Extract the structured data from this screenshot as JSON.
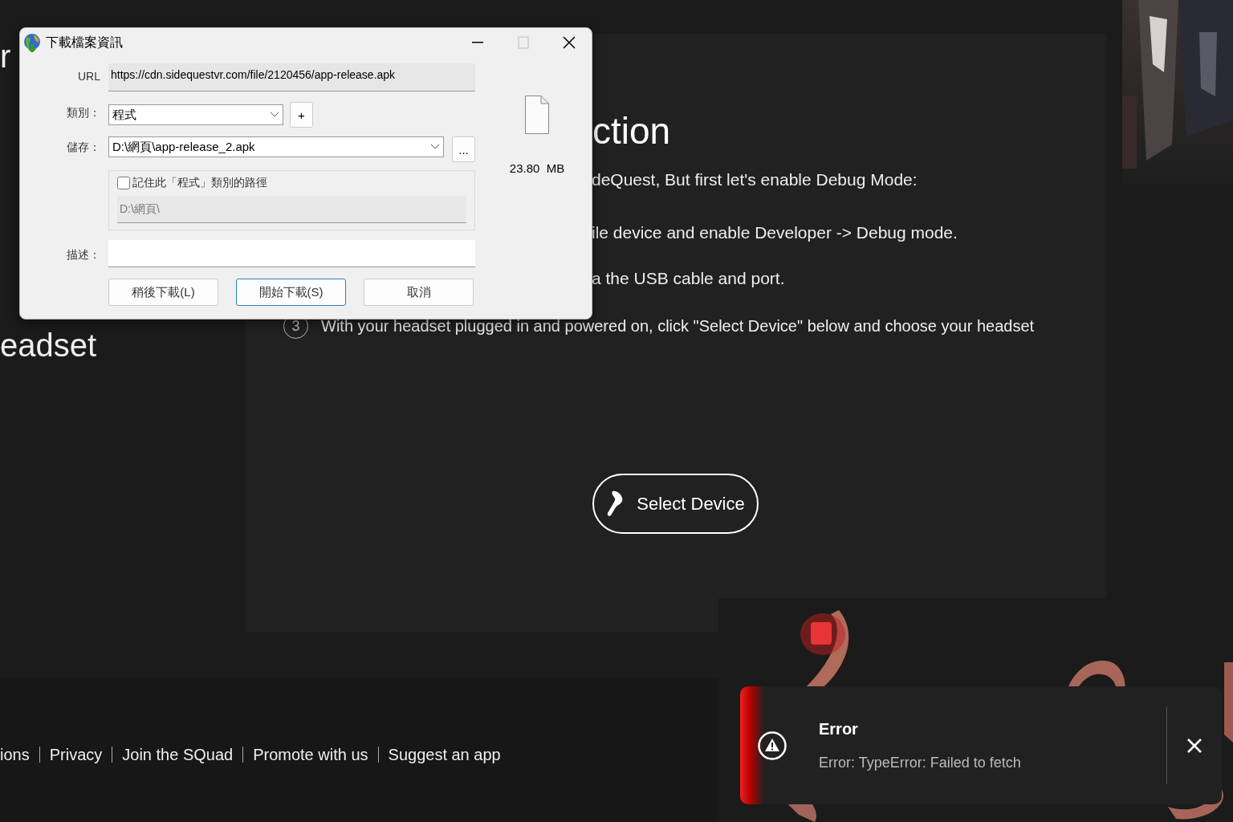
{
  "background_page": {
    "left_texts": [
      "r",
      "eadset"
    ],
    "heading": "ction",
    "lines": [
      "deQuest, But first let's enable Debug Mode:",
      "ile device and enable Developer -> Debug mode.",
      "a the USB cable and port."
    ],
    "steps": [
      {
        "number": "3",
        "text": "With your headset plugged in and powered on, click \"Select Device\" below and choose your headset"
      }
    ],
    "select_button": "Select Device",
    "footer_links": [
      "ions",
      "Privacy",
      "Join the SQuad",
      "Promote with us",
      "Suggest an app"
    ]
  },
  "dialog": {
    "title": "下載檔案資訊",
    "url_label": "URL",
    "url": "https://cdn.sidequestvr.com/file/2120456/app-release.apk",
    "category_label": "類別：",
    "category": "程式",
    "add_button": "+",
    "save_label": "儲存：",
    "save_path": "D:\\網頁\\app-release_2.apk",
    "browse_button": "...",
    "remember": {
      "label": "記住此「程式」類別的路徑",
      "checked": false
    },
    "remembered_path": "D:\\網頁\\",
    "description_label": "描述：",
    "size": "23.80  MB",
    "buttons": [
      {
        "label": "稍後下載(L)",
        "selected": false
      },
      {
        "label": "開始下載(S)",
        "selected": true
      },
      {
        "label": "取消",
        "selected": false
      }
    ]
  },
  "toast": {
    "title": "Error",
    "message": "Error: TypeError: Failed to fetch"
  }
}
